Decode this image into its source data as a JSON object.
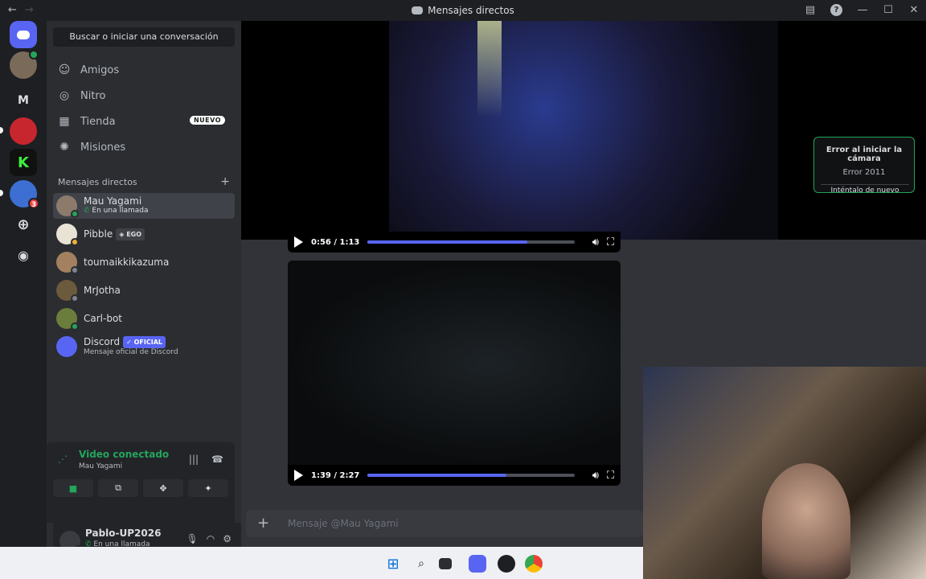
{
  "window": {
    "title": "Mensajes directos"
  },
  "rail": {
    "servers": [
      {
        "name": "home",
        "letter": ""
      },
      {
        "name": "avatar-server",
        "letter": ""
      },
      {
        "name": "m-server",
        "letter": "M"
      },
      {
        "name": "red-server",
        "letter": ""
      },
      {
        "name": "green-server",
        "letter": ""
      },
      {
        "name": "badge-server",
        "letter": "",
        "badge": "3"
      }
    ]
  },
  "sidebar": {
    "search_label": "Buscar o iniciar una conversación",
    "nav": [
      {
        "label": "Amigos",
        "icon": "friends-icon"
      },
      {
        "label": "Nitro",
        "icon": "nitro-icon"
      },
      {
        "label": "Tienda",
        "icon": "shop-icon",
        "badge": "NUEVO"
      },
      {
        "label": "Misiones",
        "icon": "quests-icon"
      }
    ],
    "dm_header": "Mensajes directos",
    "dms": [
      {
        "name": "Mau Yagami",
        "sub": "En una llamada",
        "active": true
      },
      {
        "name": "Pibble",
        "tag": "EGO"
      },
      {
        "name": "toumaikkikazuma"
      },
      {
        "name": "MrJotha"
      },
      {
        "name": "Carl-bot"
      },
      {
        "name": "Discord",
        "tag": "OFICIAL",
        "sub": "Mensaje oficial de Discord"
      }
    ]
  },
  "voice": {
    "status": "Video conectado",
    "channel": "Mau Yagami"
  },
  "user": {
    "name": "Pablo-UP2026",
    "status": "En una llamada"
  },
  "call": {
    "error_title": "Error al iniciar la cámara",
    "error_code": "Error 2011",
    "retry_label": "Inténtalo de nuevo"
  },
  "videos": [
    {
      "time": "0:56 / 1:13",
      "progress": 0.77
    },
    {
      "time": "1:39 / 2:27",
      "progress": 0.67
    }
  ],
  "composer": {
    "placeholder": "Mensaje @Mau Yagami"
  },
  "colors": {
    "accent": "#5865f2",
    "online": "#23a55a",
    "danger": "#f23f43"
  }
}
